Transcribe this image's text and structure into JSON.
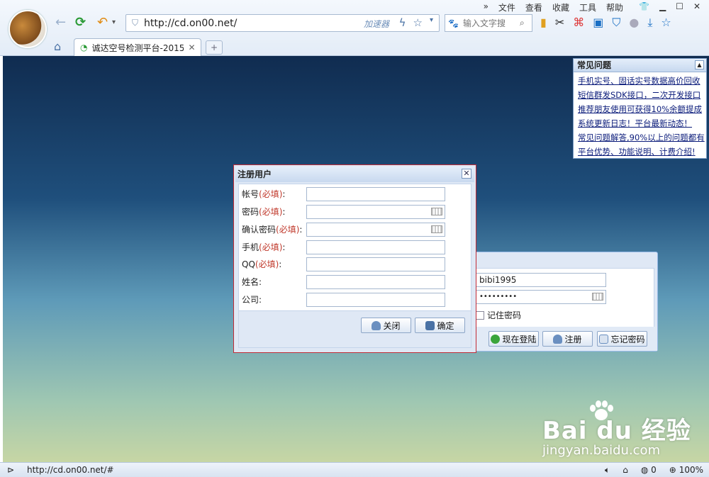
{
  "browser": {
    "menu": [
      "文件",
      "查看",
      "收藏",
      "工具",
      "帮助"
    ],
    "address": "http://cd.on00.net/",
    "accelerator": "加速器",
    "search_placeholder": "输入文字搜",
    "tab_title": "诚达空号检测平台-2015",
    "new_tab": "+"
  },
  "faq": {
    "title": "常见问题",
    "items": [
      "手机实号、固话实号数据高价回收",
      "短信群发SDK接口，二次开发接口",
      "推荐朋友使用可获得10%余额提成",
      "系统更新日志！平台最新动态！",
      "常见问题解答,90%以上的问题都有",
      "平台优势、功能说明、计费介绍!"
    ]
  },
  "login": {
    "username": "bibi1995",
    "password_mask": "•••••••••",
    "remember": "记住密码",
    "buttons": [
      "现在登陆",
      "注册",
      "忘记密码"
    ]
  },
  "register": {
    "title": "注册用户",
    "close": "✕",
    "fields": [
      {
        "label": "帐号",
        "req": "(必填)",
        "colon": ":",
        "keyboard": false
      },
      {
        "label": "密码",
        "req": "(必填)",
        "colon": ":",
        "keyboard": true
      },
      {
        "label": "确认密码",
        "req": "(必填)",
        "colon": ":",
        "keyboard": true
      },
      {
        "label": "手机",
        "req": "(必填)",
        "colon": ":",
        "keyboard": false
      },
      {
        "label": "QQ",
        "req": "(必填)",
        "colon": ":",
        "keyboard": false
      },
      {
        "label": "姓名:",
        "req": "",
        "colon": "",
        "keyboard": false
      },
      {
        "label": "公司:",
        "req": "",
        "colon": "",
        "keyboard": false
      }
    ],
    "close_btn": "关闭",
    "ok_btn": "确定"
  },
  "status": {
    "url": "http://cd.on00.net/#",
    "count": "0",
    "zoom": "100%"
  },
  "watermark": {
    "brand": "Bai du 经验",
    "site": "jingyan.baidu.com"
  }
}
